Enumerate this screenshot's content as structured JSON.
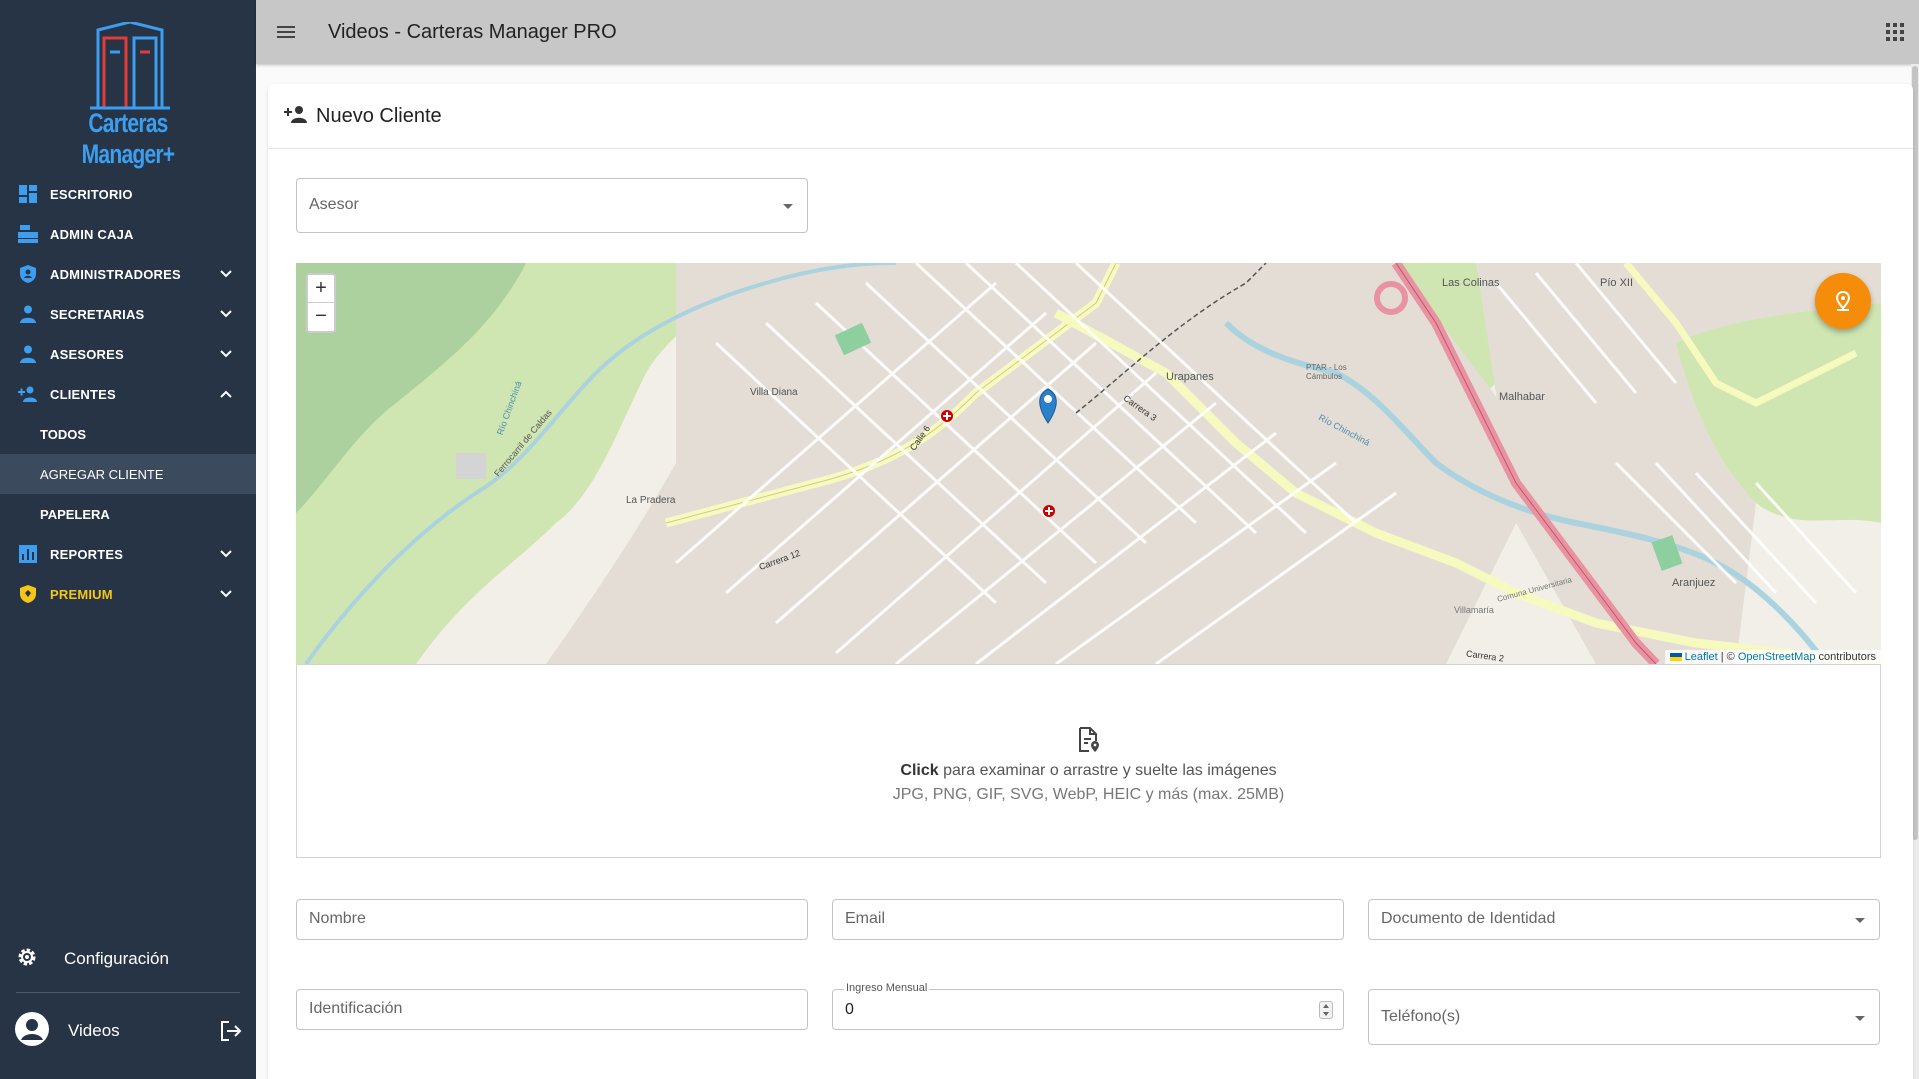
{
  "sidebar": {
    "logo_text": "Carteras Manager+",
    "items": [
      {
        "label": "ESCRITORIO"
      },
      {
        "label": "ADMIN CAJA"
      },
      {
        "label": "ADMINISTRADORES"
      },
      {
        "label": "SECRETARIAS"
      },
      {
        "label": "ASESORES"
      },
      {
        "label": "CLIENTES"
      },
      {
        "label": "REPORTES"
      },
      {
        "label": "PREMIUM"
      }
    ],
    "clientes_sub": [
      {
        "label": "TODOS"
      },
      {
        "label": "AGREGAR CLIENTE"
      },
      {
        "label": "PAPELERA"
      }
    ],
    "config_label": "Configuración",
    "user_label": "Videos"
  },
  "topbar": {
    "title": "Videos - Carteras Manager PRO"
  },
  "card": {
    "title": "Nuevo Cliente"
  },
  "form": {
    "asesor_label": "Asesor",
    "nombre_label": "Nombre",
    "email_label": "Email",
    "documento_label": "Documento de Identidad",
    "identificacion_label": "Identificación",
    "ingreso_label": "Ingreso Mensual",
    "ingreso_value": "0",
    "telefono_label": "Teléfono(s)"
  },
  "map": {
    "zoom_in": "+",
    "zoom_out": "−",
    "attribution_leaflet": "Leaflet",
    "attribution_sep": " | © ",
    "attribution_osm": "OpenStreetMap",
    "attribution_suffix": " contributors",
    "labels": {
      "villa_diana": "Villa Diana",
      "la_pradera": "La Pradera",
      "urapanes": "Urapanes",
      "las_colinas": "Las Colinas",
      "malhabar": "Malhabar",
      "pio_xii": "Pío XII",
      "aranjuez": "Aranjuez",
      "villamaria": "Villamaría",
      "ptar": "PTAR - Los Cámbulos",
      "rio_chinchina": "Río Chinchiná",
      "ferrocarril": "Ferrocarril de Caldas",
      "comuna": "Comuna Universitaria",
      "carrera_2": "Carrera 2",
      "carrera_3": "Carrera 3",
      "calle_6": "Calle 6",
      "carrera_12": "Carrera 12"
    }
  },
  "dropzone": {
    "click": "Click",
    "text": " para examinar o arrastre y suelte las imágenes",
    "formats": "JPG, PNG, GIF, SVG, WebP, HEIC y más (max. 25MB)"
  },
  "colors": {
    "sidebar_bg": "#263445",
    "topbar_bg": "#c7c7c7",
    "accent": "#3d9ef0",
    "premium": "#f5c518",
    "fab": "#f58c0a"
  }
}
